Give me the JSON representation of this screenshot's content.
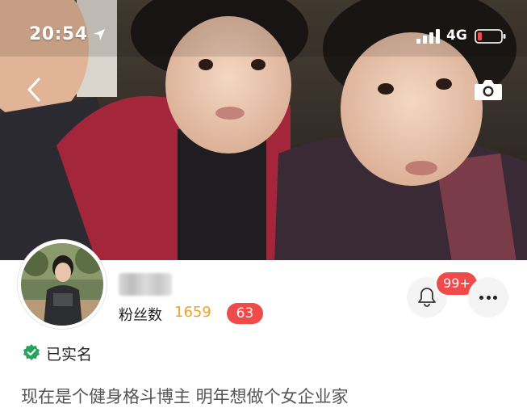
{
  "status_bar": {
    "time": "20:54",
    "network": "4G",
    "battery_color": "#f04a4a",
    "icons": [
      "location-arrow-icon",
      "signal-bars-icon",
      "battery-icon"
    ]
  },
  "nav": {
    "icons": [
      "back-chevron-icon",
      "camera-icon"
    ]
  },
  "profile": {
    "fans_label": "粉丝数",
    "fans_count": "1659",
    "fans_new": "63",
    "notification_badge": "99+",
    "verified_label": "已实名",
    "bio": "现在是个健身格斗博主 明年想做个女企业家"
  },
  "colors": {
    "accent_orange": "#f0a12a",
    "badge_red": "#f04a4a",
    "verified_green": "#2aa35a"
  }
}
